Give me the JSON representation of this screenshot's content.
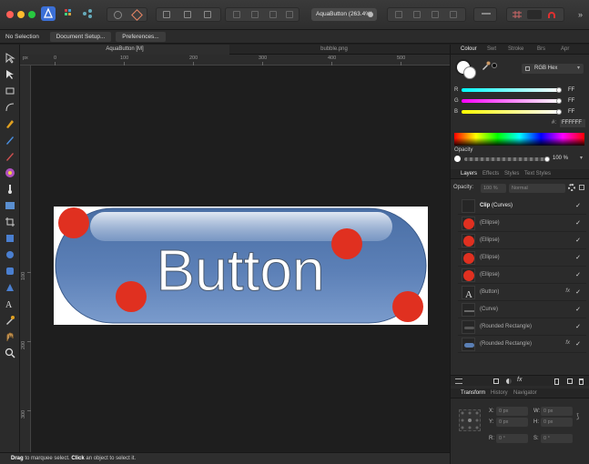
{
  "toolbar": {
    "document_name": "AquaButton (263.4%)"
  },
  "context": {
    "no_selection": "No Selection",
    "document_setup": "Document Setup...",
    "preferences": "Preferences..."
  },
  "doc_tabs": [
    "AquaButton [M]",
    "bubble.png"
  ],
  "ruler": {
    "unit": "px",
    "h_labels": [
      "0",
      "100",
      "200",
      "300",
      "400",
      "500"
    ],
    "v_labels": [
      "100",
      "200",
      "300"
    ]
  },
  "artwork": {
    "button_text": "Button"
  },
  "status": {
    "drag": "Drag",
    "text1": " to marquee select. ",
    "click": "Click",
    "text2": " an object to select it."
  },
  "color_panel": {
    "tabs": [
      "Colour",
      "Swt",
      "Stroke",
      "Brs",
      "Apr"
    ],
    "mode": "RGB Hex",
    "r_label": "R",
    "r_value": "FF",
    "g_label": "G",
    "g_value": "FF",
    "b_label": "B",
    "b_value": "FF",
    "hex_label": "#:",
    "hex_value": "FFFFFF",
    "opacity_label": "Opacity",
    "opacity_value": "100 %"
  },
  "layers_panel": {
    "tabs": [
      "Layers",
      "Effects",
      "Styles",
      "Text Styles"
    ],
    "opacity_label": "Opacity:",
    "opacity_value": "100 %",
    "blend_mode": "Normal",
    "rows": [
      {
        "name": "Clip",
        "sub": "(Curves)",
        "fx": ""
      },
      {
        "name": "(Ellipse)",
        "sub": "",
        "fx": ""
      },
      {
        "name": "(Ellipse)",
        "sub": "",
        "fx": ""
      },
      {
        "name": "(Ellipse)",
        "sub": "",
        "fx": ""
      },
      {
        "name": "(Ellipse)",
        "sub": "",
        "fx": ""
      },
      {
        "name": "(Button)",
        "sub": "",
        "fx": "fx"
      },
      {
        "name": "(Curve)",
        "sub": "",
        "fx": ""
      },
      {
        "name": "(Rounded Rectangle)",
        "sub": "",
        "fx": ""
      },
      {
        "name": "(Rounded Rectangle)",
        "sub": "",
        "fx": "fx"
      }
    ],
    "check": "✓"
  },
  "transform_panel": {
    "tabs": [
      "Transform",
      "History",
      "Navigator"
    ],
    "x_label": "X:",
    "x_value": "0 px",
    "y_label": "Y:",
    "y_value": "0 px",
    "w_label": "W:",
    "w_value": "0 px",
    "h_label": "H:",
    "h_value": "0 px",
    "r_label": "R:",
    "r_value": "0 °",
    "s_label": "S:",
    "s_value": "0 °"
  },
  "colors": {
    "accent_red": "#e03020",
    "button_blue": "#5a7fb5"
  }
}
